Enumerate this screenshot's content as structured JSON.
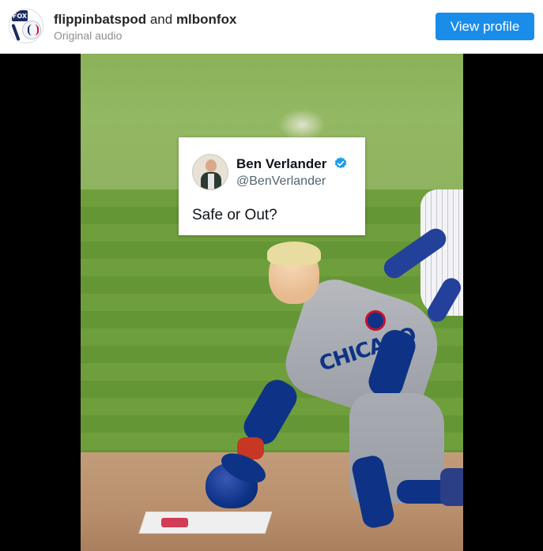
{
  "header": {
    "avatar_icon": "fox-baseball-logo-icon",
    "user_primary": "flippinbatspod",
    "separator": "and",
    "user_secondary": "mlbonfox",
    "subtitle": "Original audio",
    "view_profile_label": "View profile",
    "accent_color": "#1a8cea"
  },
  "tweet": {
    "name": "Ben Verlander",
    "handle": "@BenVerlander",
    "text": "Safe or Out?",
    "verified_icon": "verified-badge-icon",
    "verified_color": "#1d9bf0"
  },
  "video": {
    "jersey_text": "CHICAGO"
  }
}
